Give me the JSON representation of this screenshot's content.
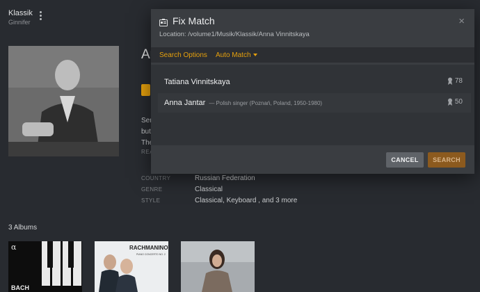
{
  "library": {
    "title": "Klassik",
    "subtitle": "Ginnifer"
  },
  "artist": {
    "name_peek": "Ar",
    "bio_lines": [
      "Ser",
      "but",
      "The"
    ],
    "read_more_peek": "REA",
    "meta": [
      {
        "key": "COUNTRY",
        "value": "Russian Federation"
      },
      {
        "key": "GENRE",
        "value": "Classical"
      },
      {
        "key": "STYLE",
        "value": "Classical, Keyboard , and 3 more"
      }
    ]
  },
  "albums": {
    "count_label": "3 Albums",
    "items": [
      {
        "alpha": "α",
        "cover_text": "BACH"
      },
      {
        "cover_title": "RACHMANINOV",
        "cover_sub": "PIANO CONCERTO NO. 2"
      },
      {}
    ]
  },
  "modal": {
    "title": "Fix Match",
    "close_glyph": "×",
    "location": "Location: /volume1/Musik/Klassik/Anna Vinnitskaya",
    "toolbar": {
      "search_options": "Search Options",
      "auto_match": "Auto Match"
    },
    "results": [
      {
        "name": "Tatiana Vinnitskaya",
        "description": "",
        "score": "78"
      },
      {
        "name": "Anna Jantar",
        "description": "— Polish singer (Poznań, Poland, 1950-1980)",
        "score": "50"
      }
    ],
    "cancel_label": "CANCEL",
    "search_label": "SEARCH"
  },
  "colors": {
    "accent": "#e5a00d",
    "background": "#282b30",
    "modal": "#3a3d41"
  }
}
